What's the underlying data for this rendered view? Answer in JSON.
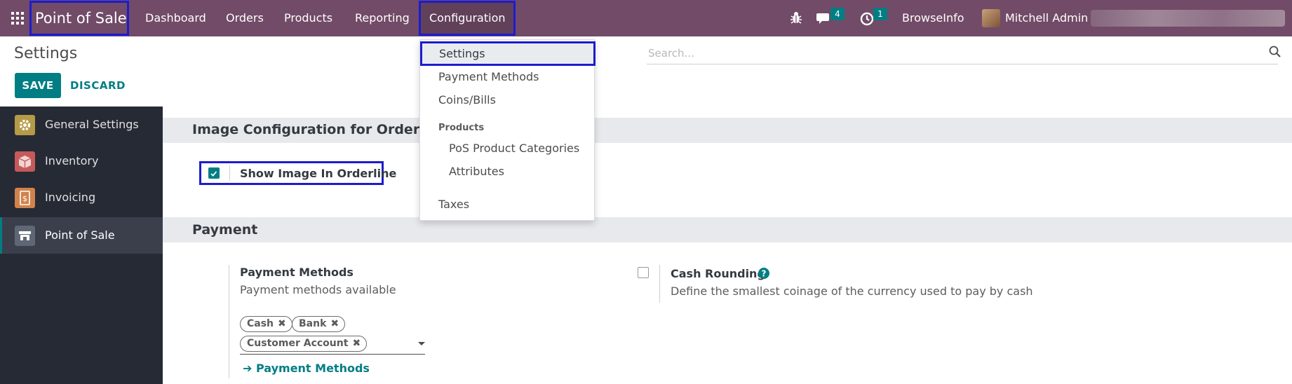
{
  "navbar": {
    "brand": "Point of Sale",
    "menus": [
      "Dashboard",
      "Orders",
      "Products",
      "Reporting"
    ],
    "config_menu": "Configuration",
    "messages_count": "4",
    "activities_count": "1",
    "company": "BrowseInfo",
    "user": "Mitchell Admin"
  },
  "control_panel": {
    "title": "Settings",
    "save_label": "SAVE",
    "discard_label": "DISCARD",
    "search_placeholder": "Search..."
  },
  "sidebar": {
    "items": [
      {
        "label": "General Settings",
        "icon": "gear-icon",
        "color": "#b59a48"
      },
      {
        "label": "Inventory",
        "icon": "box-icon",
        "color": "#c55a5a"
      },
      {
        "label": "Invoicing",
        "icon": "invoice-icon",
        "color": "#d2824b"
      },
      {
        "label": "Point of Sale",
        "icon": "store-icon",
        "color": "#5f6775"
      }
    ],
    "active_index": 3
  },
  "sections": {
    "image_config": {
      "title": "Image Configuration for Orderline",
      "show_image_label": "Show Image In Orderline",
      "show_image_checked": true
    },
    "payment": {
      "title": "Payment",
      "payment_methods_label": "Payment Methods",
      "payment_methods_desc": "Payment methods available",
      "tags": [
        "Cash",
        "Bank",
        "Customer Account"
      ],
      "payment_methods_link": "Payment Methods",
      "cash_rounding_label": "Cash Rounding",
      "cash_rounding_desc": "Define the smallest coinage of the currency used to pay by cash",
      "cash_rounding_checked": false
    }
  },
  "dropdown": {
    "settings": "Settings",
    "payment_methods": "Payment Methods",
    "coins_bills": "Coins/Bills",
    "products_header": "Products",
    "pos_categories": "PoS Product Categories",
    "attributes": "Attributes",
    "taxes": "Taxes"
  },
  "colors": {
    "navbar": "#714b67",
    "accent": "#017e84",
    "highlight_box": "#1c1ccf",
    "sidebar_bg": "#262a35"
  }
}
